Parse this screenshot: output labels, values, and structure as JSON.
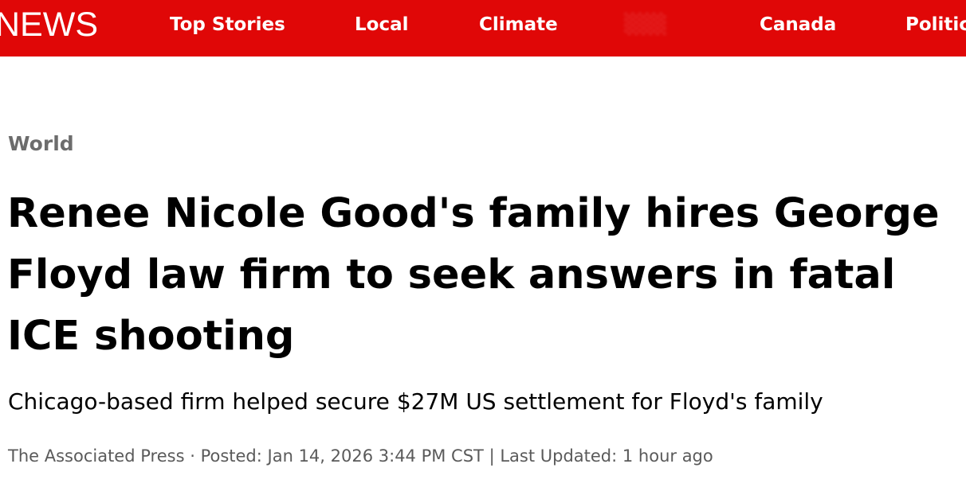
{
  "header": {
    "brand": "NEWS",
    "nav": [
      {
        "label": "Top Stories"
      },
      {
        "label": "Local"
      },
      {
        "label": "Climate"
      },
      {
        "label": "Canada"
      },
      {
        "label": "Politics"
      }
    ],
    "colors": {
      "bar": "#e00707",
      "text": "#ffffff"
    }
  },
  "article": {
    "section": "World",
    "headline": "Renee Nicole Good's family hires George Floyd law firm to seek answers in fatal ICE shooting",
    "deck": "Chicago-based firm helped secure $27M US settlement for Floyd's family",
    "byline": {
      "author": "The Associated Press",
      "separator": "·",
      "posted": "Posted: Jan 14, 2026 3:44 PM CST",
      "divider": "|",
      "updated": "Last Updated: 1 hour ago"
    }
  }
}
